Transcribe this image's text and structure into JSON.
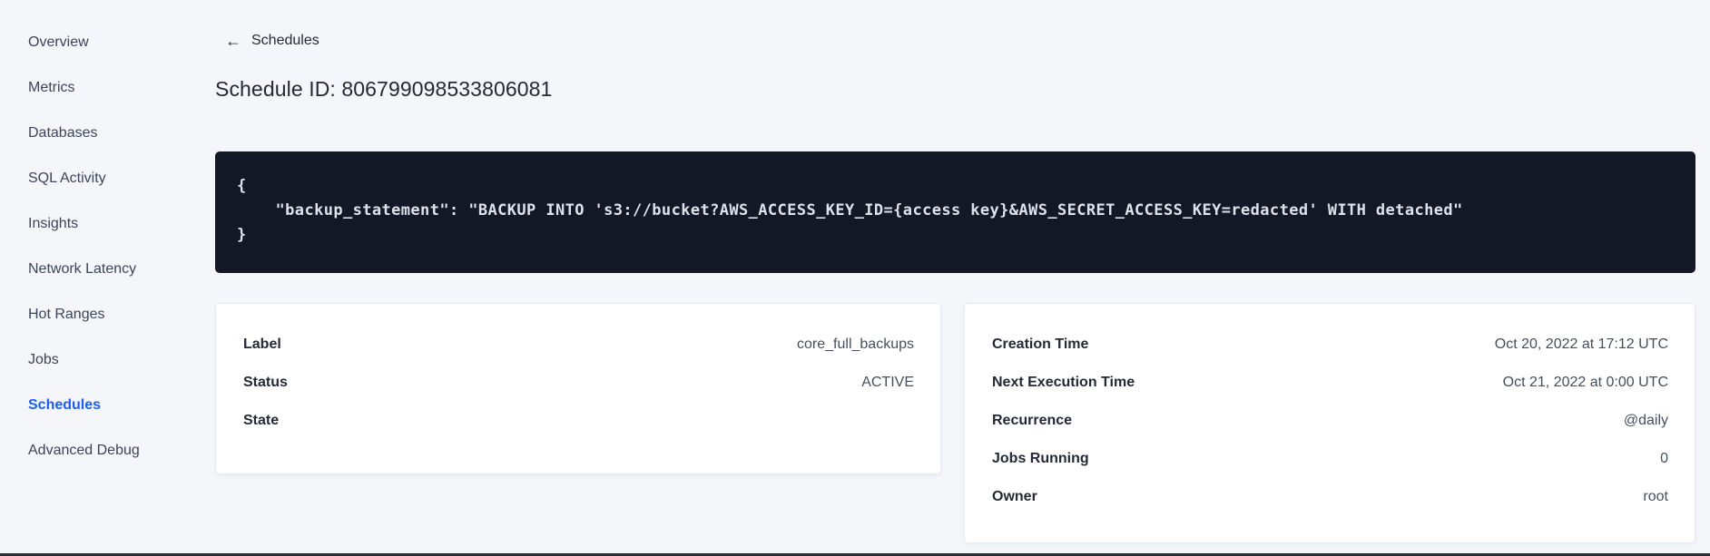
{
  "sidebar": {
    "items": [
      {
        "label": "Overview",
        "active": false
      },
      {
        "label": "Metrics",
        "active": false
      },
      {
        "label": "Databases",
        "active": false
      },
      {
        "label": "SQL Activity",
        "active": false
      },
      {
        "label": "Insights",
        "active": false
      },
      {
        "label": "Network Latency",
        "active": false
      },
      {
        "label": "Hot Ranges",
        "active": false
      },
      {
        "label": "Jobs",
        "active": false
      },
      {
        "label": "Schedules",
        "active": true
      },
      {
        "label": "Advanced Debug",
        "active": false
      }
    ]
  },
  "header": {
    "back_icon": "arrow-left",
    "back_label": "Schedules",
    "title": "Schedule ID: 806799098533806081"
  },
  "code_block": {
    "text": "{\n    \"backup_statement\": \"BACKUP INTO 's3://bucket?AWS_ACCESS_KEY_ID={access key}&AWS_SECRET_ACCESS_KEY=redacted' WITH detached\"\n}"
  },
  "cards": {
    "left": {
      "rows": [
        {
          "label": "Label",
          "value": "core_full_backups"
        },
        {
          "label": "Status",
          "value": "ACTIVE"
        },
        {
          "label": "State",
          "value": ""
        }
      ]
    },
    "right": {
      "rows": [
        {
          "label": "Creation Time",
          "value": "Oct 20, 2022 at 17:12 UTC"
        },
        {
          "label": "Next Execution Time",
          "value": "Oct 21, 2022 at 0:00 UTC"
        },
        {
          "label": "Recurrence",
          "value": "@daily"
        },
        {
          "label": "Jobs Running",
          "value": "0"
        },
        {
          "label": "Owner",
          "value": "root"
        }
      ]
    }
  },
  "colors": {
    "page_background": "#f4f6fa",
    "active_link_blue": "#1c5ef5",
    "code_background": "#121826",
    "code_text": "#dee3eb",
    "heading_text": "#242a35",
    "body_text": "#3c4558",
    "card_background": "#ffffff",
    "card_border": "#e6ebf2"
  }
}
